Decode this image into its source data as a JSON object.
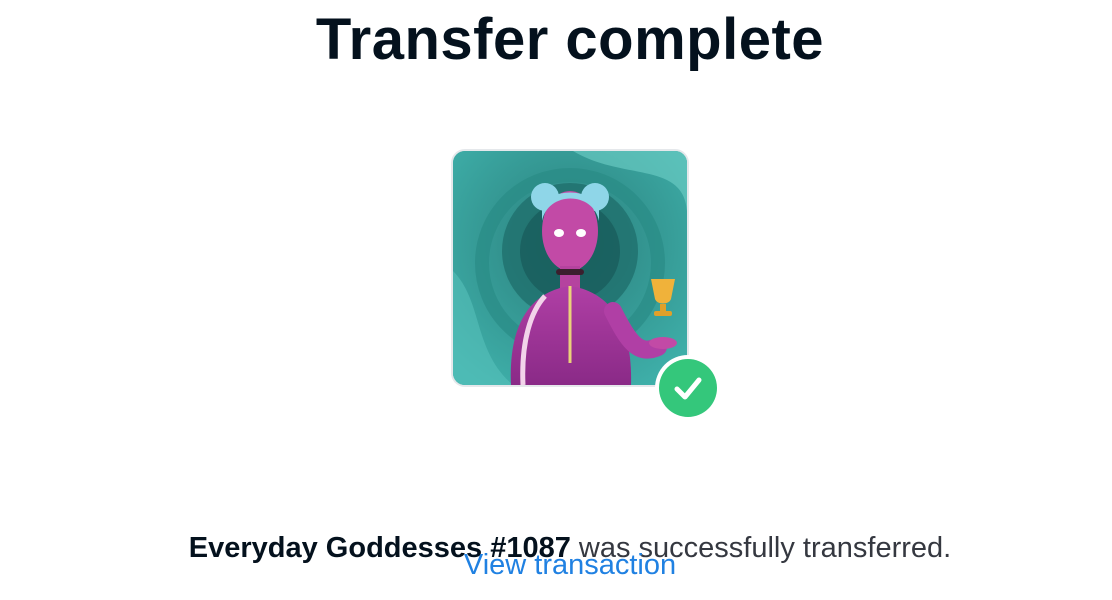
{
  "header": {
    "title": "Transfer complete"
  },
  "nft": {
    "name": "Everyday Goddesses #1087",
    "image_icon": "goddess-avatar-image",
    "status_icon": "check-circle-icon"
  },
  "message": {
    "suffix": " was successfully transferred."
  },
  "link": {
    "view_transaction": "View transaction"
  },
  "colors": {
    "text_primary": "#04111d",
    "text_secondary": "#353840",
    "link": "#2081e2",
    "success": "#34c77b"
  }
}
